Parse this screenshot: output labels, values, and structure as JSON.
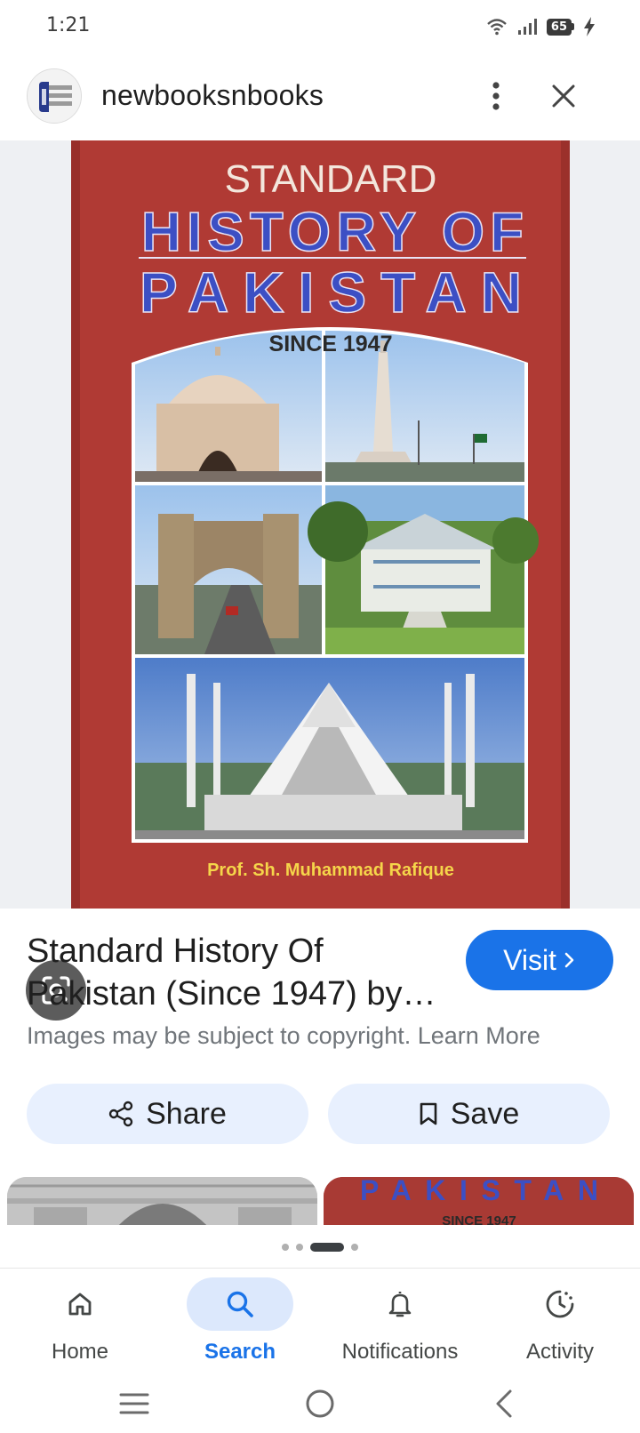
{
  "status_bar": {
    "time": "1:21",
    "battery_level": "65",
    "icons": [
      "wifi-icon",
      "signal-icon",
      "battery-icon",
      "charging-icon"
    ]
  },
  "header": {
    "site_name": "newbooksnbooks",
    "logo_icon": "site-logo",
    "actions": [
      "more-vert-icon",
      "close-icon"
    ]
  },
  "book_cover": {
    "line1": "STANDARD",
    "line2": "HISTORY OF",
    "line3": "PAKISTAN",
    "subtitle": "SINCE 1947",
    "author": "Prof. Sh. Muhammad Rafique",
    "colors": {
      "cover_red": "#b03a34",
      "title_blue": "#3c4fc4",
      "author_yellow": "#f5d54a"
    }
  },
  "result": {
    "title": "Standard History Of Pakistan (Since 1947) by…",
    "visit_label": "Visit",
    "copyright_text": "Images may be subject to copyright. Learn More"
  },
  "actions": {
    "share_label": "Share",
    "save_label": "Save"
  },
  "thumbnails": {
    "thumb2_title": "PAKISTAN",
    "thumb2_subtitle": "SINCE 1947"
  },
  "pagination": {
    "count": 4,
    "active_index": 2
  },
  "bottom_nav": {
    "items": [
      {
        "label": "Home",
        "icon": "home-icon"
      },
      {
        "label": "Search",
        "icon": "search-icon",
        "active": true
      },
      {
        "label": "Notifications",
        "icon": "bell-icon"
      },
      {
        "label": "Activity",
        "icon": "activity-icon"
      }
    ]
  },
  "colors": {
    "accent": "#1a73e8",
    "chip_bg": "#e8f0fe",
    "viewer_bg": "#eef0f3"
  }
}
